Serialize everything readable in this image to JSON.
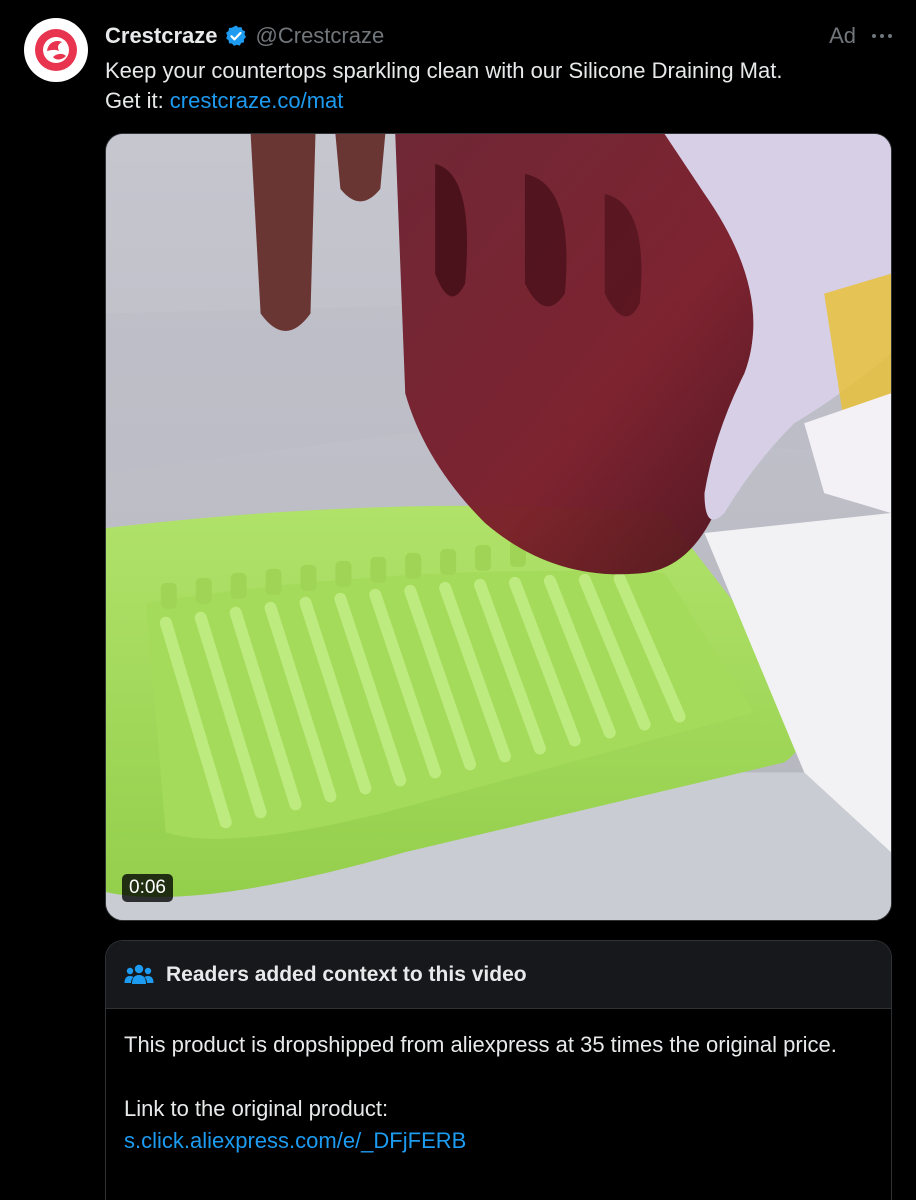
{
  "post": {
    "display_name": "Crestcraze",
    "handle": "@Crestcraze",
    "ad_label": "Ad",
    "text_line1": "Keep your countertops sparkling clean with our Silicone Draining Mat.",
    "text_line2_prefix": "Get it: ",
    "link": "crestcraze.co/mat",
    "video_duration": "0:06"
  },
  "community_note": {
    "title": "Readers added context to this video",
    "body": "This product is dropshipped from aliexpress at 35 times the original price.",
    "link_intro": "Link to the original product:",
    "link": "s.click.aliexpress.com/e/_DFjFERB"
  },
  "icons": {
    "avatar": "crestcraze-logo",
    "verified": "verified-badge-icon",
    "more": "more-icon",
    "note": "people-icon"
  },
  "colors": {
    "accent": "#1d9bf0",
    "background": "#000000",
    "text": "#e7e9ea",
    "muted": "#71767b",
    "mat_green": "#a8e05f"
  }
}
